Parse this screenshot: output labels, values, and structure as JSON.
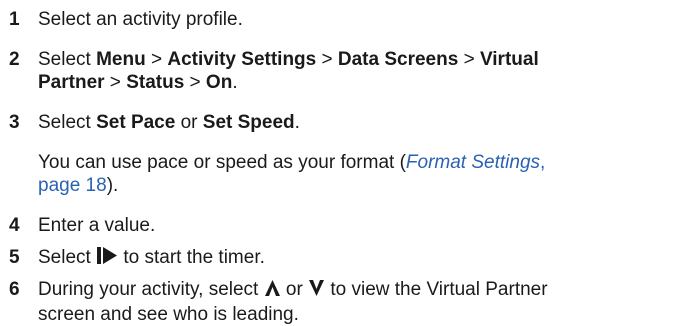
{
  "steps": [
    {
      "num": "1",
      "text": "Select an activity profile."
    },
    {
      "num": "2",
      "pre": "Select ",
      "menu": "Menu",
      "sep": " > ",
      "activity_settings": "Activity Settings",
      "data_screens": "Data Screens",
      "virtual": "Virtual",
      "partner": "Partner",
      "status": "Status",
      "on": "On",
      "end": "."
    },
    {
      "num": "3",
      "pre": "Select ",
      "set_pace": "Set Pace",
      "or": " or ",
      "set_speed": "Set Speed",
      "end": "."
    },
    {
      "num": "4",
      "text": "Enter a value."
    },
    {
      "num": "5",
      "pre": "Select ",
      "post": " to start the timer."
    },
    {
      "num": "6",
      "pre": "During your activity, select ",
      "or": " or ",
      "post_line1": " to view the Virtual Partner",
      "line2": "screen and see who is leading."
    }
  ],
  "note": {
    "pre": "You can use pace or speed as your format (",
    "link": "Format Settings",
    "comma": ",",
    "page": "page 18",
    "end": ")."
  },
  "icons": {
    "start_timer": "play-pause-icon",
    "up": "up-arrow-icon",
    "down": "down-arrow-icon"
  },
  "colors": {
    "text": "#1a1a1a",
    "link": "#2a62b3"
  }
}
